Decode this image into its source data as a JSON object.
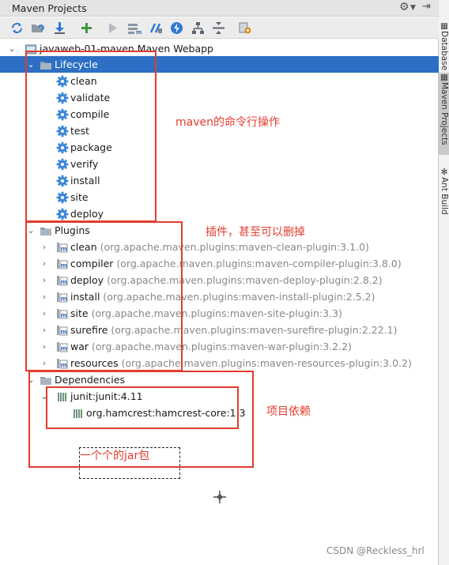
{
  "window": {
    "title": "Maven Projects"
  },
  "toolbar": {
    "buttons": [
      "reimport-icon",
      "generate-sources-icon",
      "download-icon",
      "add-icon",
      "run-icon",
      "execute-goal-icon",
      "toggle-offline-icon",
      "skip-tests-icon",
      "dependencies-icon",
      "collapse-icon",
      "settings-icon"
    ]
  },
  "tree": {
    "project": "javaweb-01-maven Maven Webapp",
    "lifecycle": {
      "label": "Lifecycle",
      "items": [
        "clean",
        "validate",
        "compile",
        "test",
        "package",
        "verify",
        "install",
        "site",
        "deploy"
      ]
    },
    "plugins": {
      "label": "Plugins",
      "items": [
        {
          "name": "clean",
          "detail": "(org.apache.maven.plugins:maven-clean-plugin:3.1.0)"
        },
        {
          "name": "compiler",
          "detail": "(org.apache.maven.plugins:maven-compiler-plugin:3.8.0)"
        },
        {
          "name": "deploy",
          "detail": "(org.apache.maven.plugins:maven-deploy-plugin:2.8.2)"
        },
        {
          "name": "install",
          "detail": "(org.apache.maven.plugins:maven-install-plugin:2.5.2)"
        },
        {
          "name": "site",
          "detail": "(org.apache.maven.plugins:maven-site-plugin:3.3)"
        },
        {
          "name": "surefire",
          "detail": "(org.apache.maven.plugins:maven-surefire-plugin:2.22.1)"
        },
        {
          "name": "war",
          "detail": "(org.apache.maven.plugins:maven-war-plugin:3.2.2)"
        },
        {
          "name": "resources",
          "detail": "(org.apache.maven.plugins:maven-resources-plugin:3.0.2)"
        }
      ]
    },
    "dependencies": {
      "label": "Dependencies",
      "junit": "junit:junit:4.11",
      "hamcrest": "org.hamcrest:hamcrest-core:1.3"
    }
  },
  "annotations": {
    "lifecycle": "maven的命令行操作",
    "plugins": "插件，甚至可以删掉",
    "dependencies": "项目依赖",
    "jar": "一个个的jar包"
  },
  "side_tabs": {
    "database": "Database",
    "maven": "Maven Projects",
    "ant": "Ant Build"
  },
  "watermark": "CSDN @Reckless_hrl",
  "colors": {
    "selection": "#2d6fc4",
    "annotation": "#e23c2f",
    "gear": "#3d87d8"
  }
}
